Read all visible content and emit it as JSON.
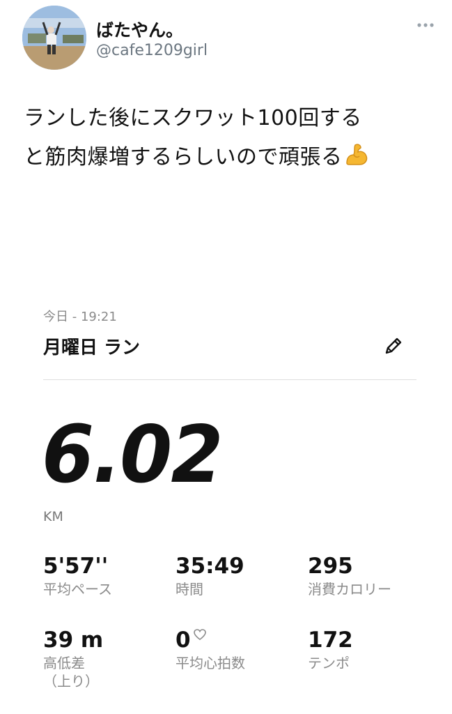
{
  "tweet": {
    "display_name": "ばたやん。",
    "handle": "@cafe1209girl",
    "text_line1": "ランした後にスクワット100回する",
    "text_line2": "と筋肉爆増するらしいので頑張る",
    "emoji": "flexed-biceps-icon"
  },
  "activity": {
    "date": "今日 - 19:21",
    "title": "月曜日 ラン",
    "distance": "6.02",
    "distance_unit": "KM",
    "stats": [
      {
        "value": "5'57''",
        "label": "平均ペース"
      },
      {
        "value": "35:49",
        "label": "時間"
      },
      {
        "value": "295",
        "label": "消費カロリー"
      },
      {
        "value": "39 m",
        "label": "高低差\n（上り）"
      },
      {
        "value": "0",
        "label": "平均心拍数"
      },
      {
        "value": "172",
        "label": "テンポ"
      }
    ]
  },
  "colors": {
    "muted": "#8a8a8a",
    "handle": "#6b7680",
    "text": "#111111"
  }
}
